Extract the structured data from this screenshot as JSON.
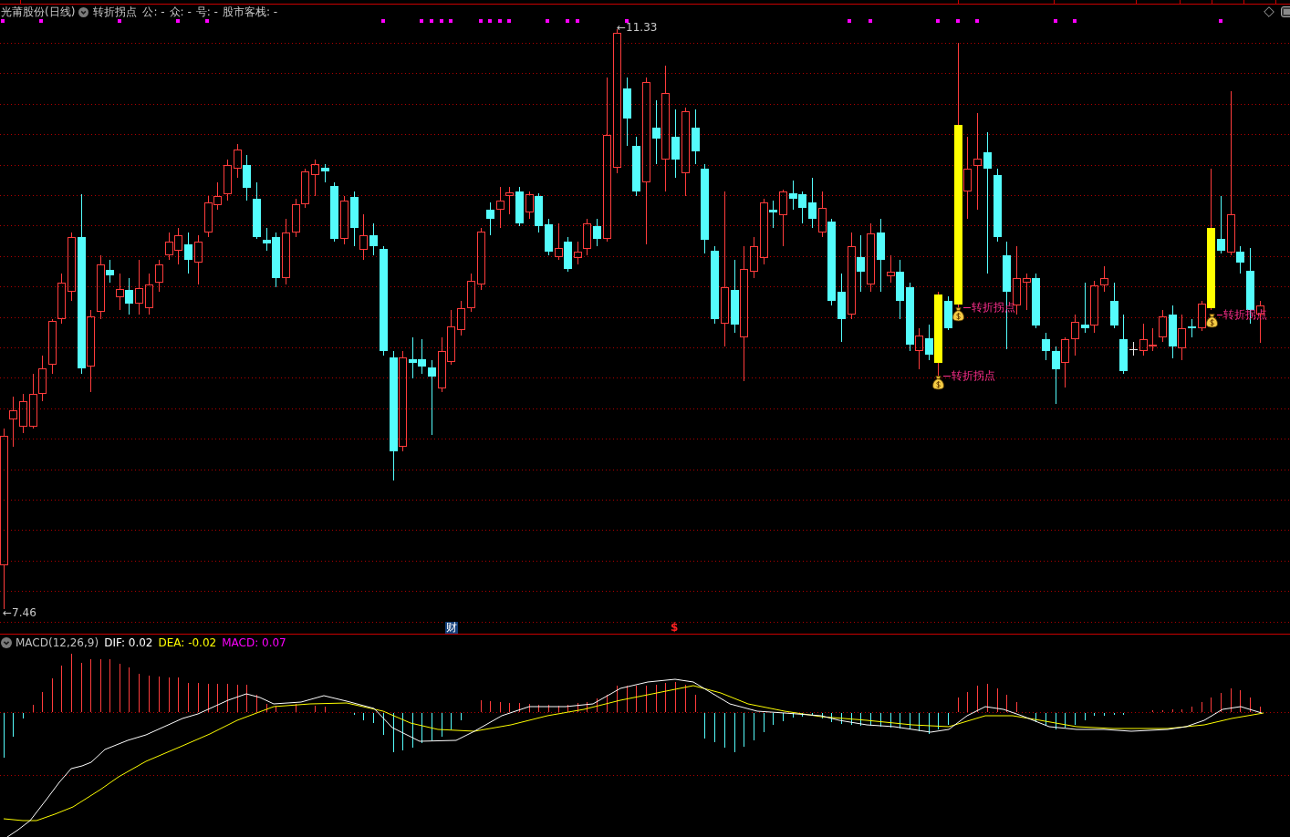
{
  "header": {
    "title": "光莆股份(日线)",
    "indicator": "转折拐点",
    "fields": [
      "公: -",
      "众: -",
      "号: -",
      "股市客栈: -"
    ]
  },
  "price_chart": {
    "high_label": "←11.33",
    "low_label": "←7.46",
    "signals": [
      {
        "label": "转折拐点"
      },
      {
        "label": "转折拐点"
      },
      {
        "label": "转折拐点"
      }
    ],
    "event_markers": [
      {
        "kind": "finance",
        "text": "财"
      },
      {
        "kind": "dollar",
        "text": "$"
      }
    ]
  },
  "macd": {
    "title": "MACD(12,26,9)",
    "legend": [
      {
        "text": "DIF: 0.02",
        "color": "#ffffff"
      },
      {
        "text": "DEA: -0.02",
        "color": "#ffff00"
      },
      {
        "text": "MACD: 0.07",
        "color": "#ff00ff"
      }
    ]
  }
}
